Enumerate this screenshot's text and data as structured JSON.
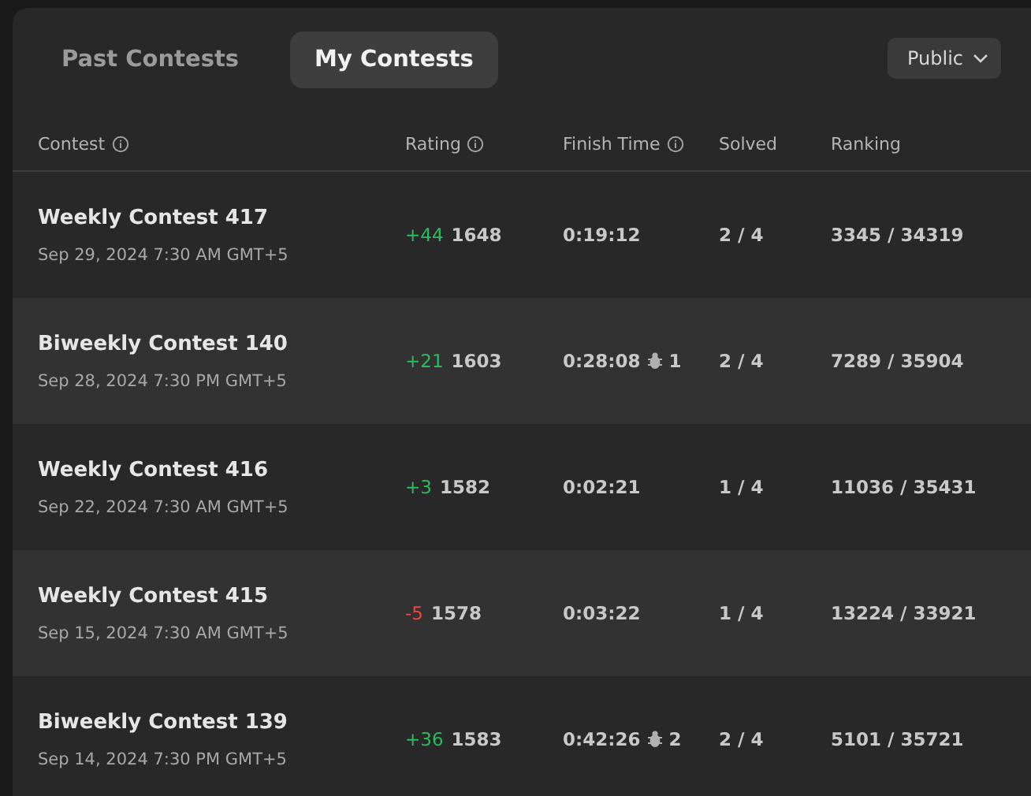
{
  "tabs": [
    {
      "label": "Past Contests",
      "selected": false
    },
    {
      "label": "My Contests",
      "selected": true
    }
  ],
  "visibility": {
    "label": "Public"
  },
  "columns": [
    {
      "label": "Contest",
      "info": true
    },
    {
      "label": "Rating",
      "info": true
    },
    {
      "label": "Finish Time",
      "info": true
    },
    {
      "label": "Solved",
      "info": false
    },
    {
      "label": "Ranking",
      "info": false
    }
  ],
  "rows": [
    {
      "name": "Weekly Contest 417",
      "date": "Sep 29, 2024 7:30 AM GMT+5",
      "change": "+44",
      "color": "#2cbb5d",
      "rating": "1648",
      "finish_time": "0:19:12",
      "solved": "2 / 4",
      "ranking": "3345 / 34319"
    },
    {
      "name": "Biweekly Contest 140",
      "date": "Sep 28, 2024 7:30 PM GMT+5",
      "change": "+21",
      "color": "#2cbb5d",
      "rating": "1603",
      "finish_time": "0:28:08",
      "bugs": "1",
      "solved": "2 / 4",
      "ranking": "7289 / 35904"
    },
    {
      "name": "Weekly Contest 416",
      "date": "Sep 22, 2024 7:30 AM GMT+5",
      "change": "+3",
      "color": "#2cbb5d",
      "rating": "1582",
      "finish_time": "0:02:21",
      "solved": "1 / 4",
      "ranking": "11036 / 35431"
    },
    {
      "name": "Weekly Contest 415",
      "date": "Sep 15, 2024 7:30 AM GMT+5",
      "change": "-5",
      "color": "#ef4743",
      "rating": "1578",
      "finish_time": "0:03:22",
      "solved": "1 / 4",
      "ranking": "13224 / 33921"
    },
    {
      "name": "Biweekly Contest 139",
      "date": "Sep 14, 2024 7:30 PM GMT+5",
      "change": "+36",
      "color": "#2cbb5d",
      "rating": "1583",
      "finish_time": "0:42:26",
      "bugs": "2",
      "solved": "2 / 4",
      "ranking": "5101 / 35721"
    }
  ]
}
